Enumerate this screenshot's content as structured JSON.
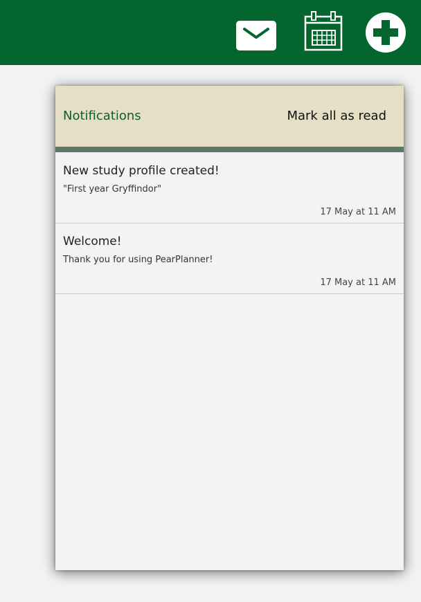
{
  "topbar": {
    "icons": [
      "mail-icon",
      "calendar-icon",
      "add-icon"
    ],
    "background_color": "#05652f"
  },
  "panel": {
    "title": "Notifications",
    "mark_all_label": "Mark all as read",
    "header_color": "#e5dfc6",
    "notifications": [
      {
        "title": "New study profile created!",
        "body": "\"First year Gryffindor\"",
        "time": "17 May at 11 AM"
      },
      {
        "title": "Welcome!",
        "body": "Thank you for using PearPlanner!",
        "time": "17 May at 11 AM"
      }
    ]
  }
}
